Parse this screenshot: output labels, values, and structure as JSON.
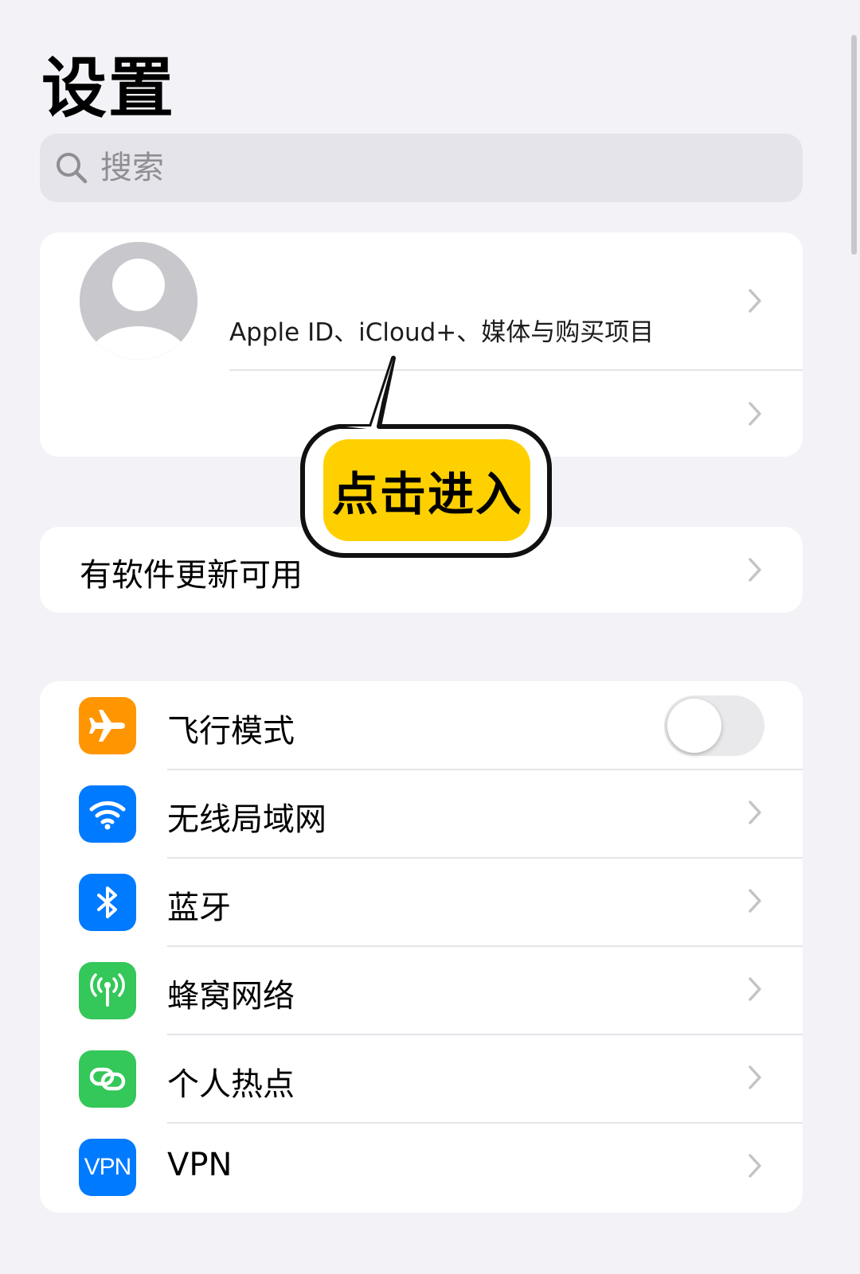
{
  "header": {
    "title": "设置"
  },
  "search": {
    "placeholder": "搜索"
  },
  "profile": {
    "subtitle": "Apple ID、iCloud+、媒体与购买项目"
  },
  "update": {
    "label": "有软件更新可用"
  },
  "network": {
    "items": [
      {
        "label": "飞行模式",
        "icon": "airplane-icon",
        "color": "#ff9500",
        "toggle": false
      },
      {
        "label": "无线局域网",
        "icon": "wifi-icon",
        "color": "#007aff"
      },
      {
        "label": "蓝牙",
        "icon": "bluetooth-icon",
        "color": "#007aff"
      },
      {
        "label": "蜂窝网络",
        "icon": "cellular-icon",
        "color": "#34c759"
      },
      {
        "label": "个人热点",
        "icon": "hotspot-icon",
        "color": "#34c759"
      },
      {
        "label": "VPN",
        "icon": "vpn-icon",
        "color": "#007aff",
        "badge": "VPN"
      }
    ]
  },
  "callout": {
    "label": "点击进入",
    "fill": "#ffd000"
  }
}
